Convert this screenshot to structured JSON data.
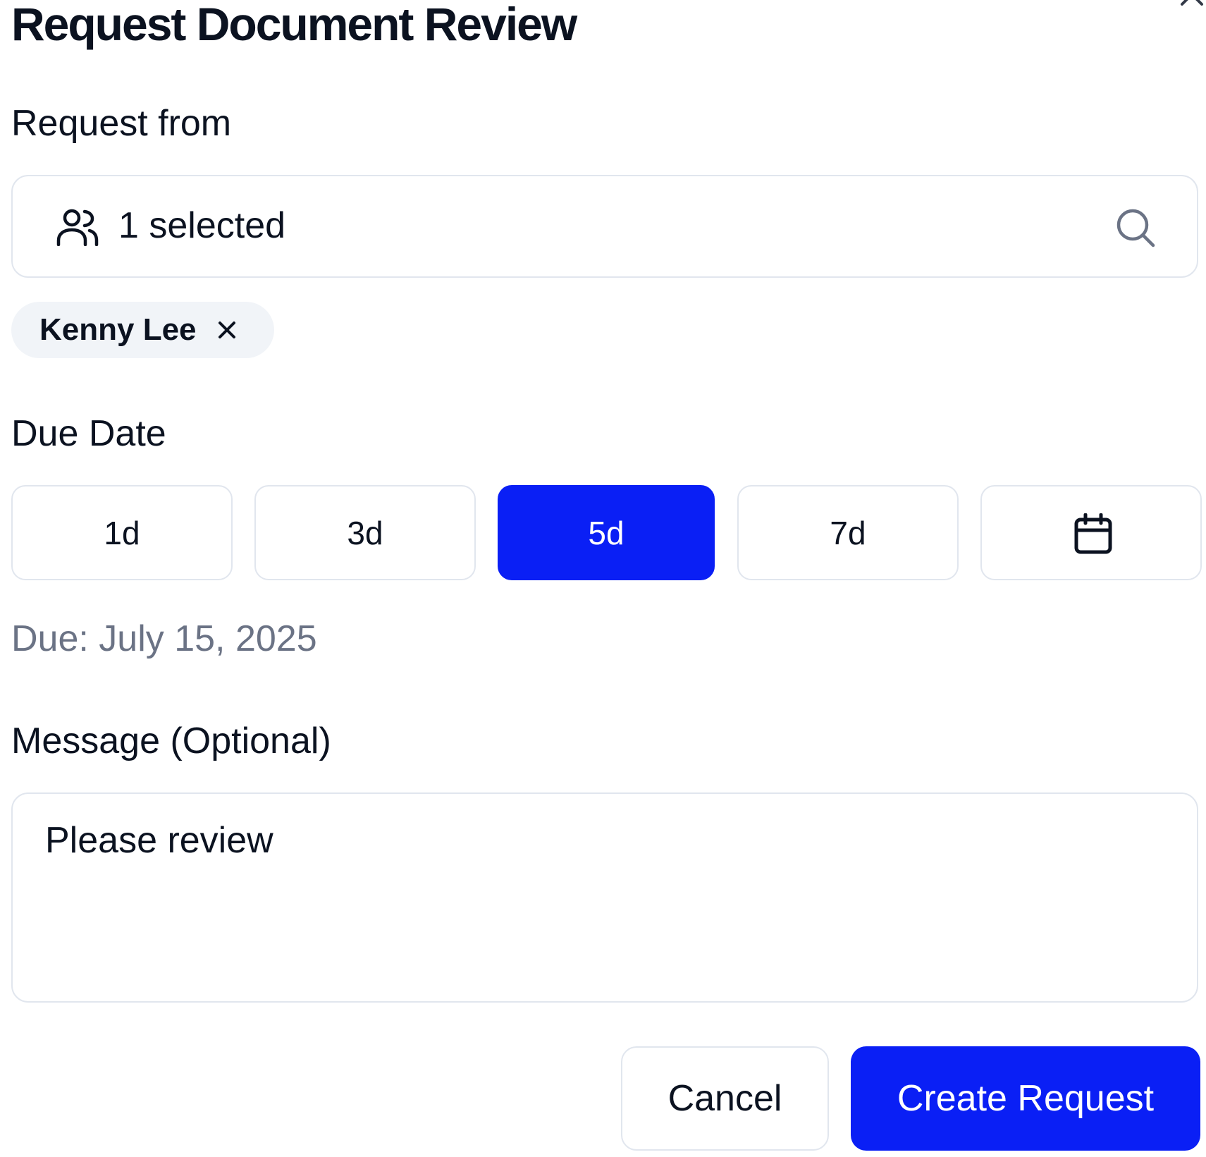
{
  "dialog": {
    "title": "Request Document Review",
    "close_icon": "close-icon"
  },
  "request_from": {
    "label": "Request from",
    "selected_text": "1 selected",
    "leading_icon": "people-icon",
    "trailing_icon": "search-icon",
    "chips": [
      {
        "name": "Kenny Lee",
        "remove_icon": "x-icon"
      }
    ]
  },
  "due_date": {
    "label": "Due Date",
    "options": [
      "1d",
      "3d",
      "5d",
      "7d"
    ],
    "selected": "5d",
    "calendar_icon": "calendar-icon",
    "due_text": "Due: July 15, 2025"
  },
  "message": {
    "label": "Message (Optional)",
    "value": "Please review"
  },
  "actions": {
    "cancel_label": "Cancel",
    "create_label": "Create Request"
  },
  "colors": {
    "primary": "#0a1ff5",
    "border": "#e1e6ee",
    "chip_bg": "#f1f4f8",
    "muted_text": "#6b7385",
    "text": "#0b1220"
  }
}
